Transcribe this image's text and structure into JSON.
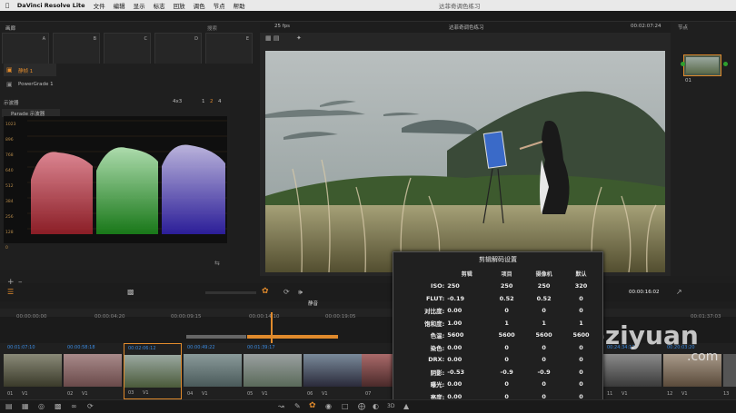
{
  "menubar": {
    "apple": "",
    "app": "DaVinci Resolve Lite",
    "items": [
      "文件",
      "编辑",
      "显示",
      "标志",
      "回放",
      "调色",
      "节点",
      "帮助"
    ],
    "window_title": "达菲奇调色练习"
  },
  "gallery": {
    "title": "画廊",
    "search_label": "搜索",
    "node_labels": [
      "A",
      "B",
      "C",
      "D",
      "E"
    ]
  },
  "stills": {
    "items": [
      "静帧 1",
      "PowerGrade 1"
    ]
  },
  "scope": {
    "title": "示波器",
    "type": "Parade 示波器",
    "ratio": "4x3",
    "pages": [
      "1",
      "2",
      "4"
    ],
    "ticks": [
      "1023",
      "896",
      "768",
      "640",
      "512",
      "384",
      "256",
      "128",
      "0"
    ]
  },
  "viewer": {
    "fps": "25 fps",
    "clip_name": "达菲奇调色练习",
    "timecode": "00:02:07:24",
    "node_label": "节点"
  },
  "nodes": {
    "node_id": "01"
  },
  "transport": {
    "timecode": "00:00:16:02",
    "mute_tooltip": "静音"
  },
  "timeline": {
    "ticks": [
      "00:00:00:00",
      "00:00:04:20",
      "00:00:09:15",
      "00:00:14:10",
      "00:00:19:05",
      "00:01:37:03"
    ]
  },
  "clips": [
    {
      "tc": "00:01:07:10",
      "name": "01",
      "track": "V1"
    },
    {
      "tc": "00:00:58:18",
      "name": "02",
      "track": "V1"
    },
    {
      "tc": "00:02:06:12",
      "name": "03",
      "track": "V1"
    },
    {
      "tc": "00:00:49:22",
      "name": "04",
      "track": "V1"
    },
    {
      "tc": "00:01:39:17",
      "name": "05",
      "track": "V1"
    },
    {
      "tc": "",
      "name": "06",
      "track": "V1"
    },
    {
      "tc": "",
      "name": "07",
      "track": "V1"
    },
    {
      "tc": "00:24:34:12",
      "name": "11",
      "track": "V1"
    },
    {
      "tc": "00:20:03:20",
      "name": "12",
      "track": "V1"
    },
    {
      "tc": "",
      "name": "13",
      "track": "V1"
    }
  ],
  "popup": {
    "title": "剪辑解码设置",
    "headers": [
      "剪辑",
      "项目",
      "摄像机",
      "默认"
    ],
    "rows": [
      {
        "label": "ISO:",
        "clip": "250",
        "project": "250",
        "camera": "250",
        "default": "320"
      },
      {
        "label": "FLUT:",
        "clip": "-0.19",
        "project": "0.52",
        "camera": "0.52",
        "default": "0"
      },
      {
        "label": "对比度:",
        "clip": "0.00",
        "project": "0",
        "camera": "0",
        "default": "0"
      },
      {
        "label": "饱和度:",
        "clip": "1.00",
        "project": "1",
        "camera": "1",
        "default": "1"
      },
      {
        "label": "色温:",
        "clip": "5600",
        "project": "5600",
        "camera": "5600",
        "default": "5600"
      },
      {
        "label": "染色:",
        "clip": "0.00",
        "project": "0",
        "camera": "0",
        "default": "0"
      },
      {
        "label": "DRX:",
        "clip": "0.00",
        "project": "0",
        "camera": "0",
        "default": "0"
      },
      {
        "label": "阴影:",
        "clip": "-0.53",
        "project": "-0.9",
        "camera": "-0.9",
        "default": "0"
      },
      {
        "label": "曝光:",
        "clip": "0.00",
        "project": "0",
        "camera": "0",
        "default": "0"
      },
      {
        "label": "亮度:",
        "clip": "0.00",
        "project": "0",
        "camera": "0",
        "default": "0"
      }
    ]
  },
  "watermark": {
    "text": "aeziyuan",
    "sub": ".com"
  },
  "colors": {
    "accent": "#e08a2c",
    "timecode_blue": "#3a8ae0",
    "red": "#ff5a6a",
    "green": "#66ff66",
    "blue": "#7a6aff"
  }
}
